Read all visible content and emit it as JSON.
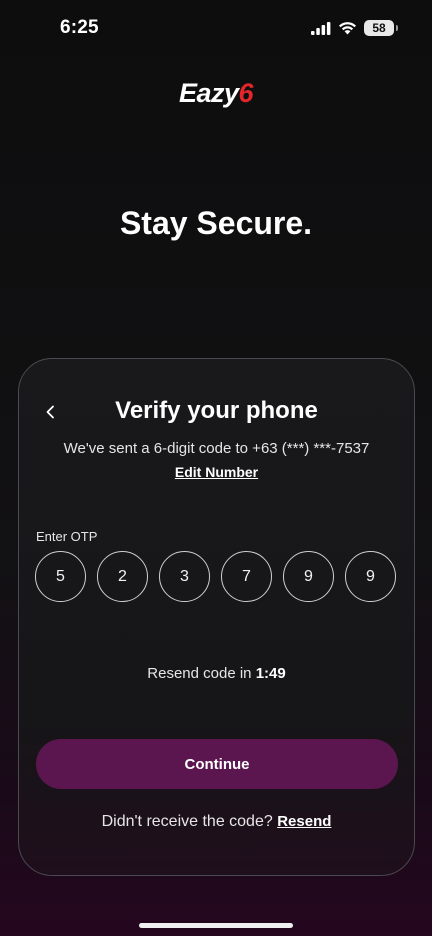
{
  "status_bar": {
    "time": "6:25",
    "battery": "58"
  },
  "logo": {
    "text": "Eazy",
    "accent": "6"
  },
  "hero_title": "Stay Secure.",
  "verify": {
    "title": "Verify your phone",
    "sent_text": "We've sent a 6-digit code to +63 (***) ***-7537",
    "edit_number": "Edit Number",
    "otp_label": "Enter OTP",
    "otp_digits": [
      "5",
      "2",
      "3",
      "7",
      "9",
      "9"
    ],
    "resend_prefix": "Resend code in",
    "resend_countdown": "1:49",
    "continue_label": "Continue",
    "didnt_receive": "Didn't receive the code?",
    "resend_label": "Resend"
  },
  "colors": {
    "accent_brand": "#e4262b",
    "button": "#5b1650"
  },
  "icons": {
    "back": "chevron-left-icon",
    "signal": "signal-bars-icon",
    "wifi": "wifi-icon",
    "battery": "battery-icon"
  }
}
